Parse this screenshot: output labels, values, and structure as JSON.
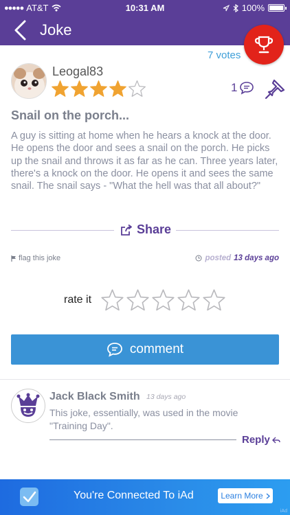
{
  "status_bar": {
    "carrier": "AT&T",
    "time": "10:31 AM",
    "battery": "100%"
  },
  "nav": {
    "title": "Joke"
  },
  "joke": {
    "votes": "7 votes",
    "author": "Leogal83",
    "rating": 4,
    "rating_max": 5,
    "comment_count": "1",
    "title": "Snail on the porch...",
    "body": "A guy is sitting at home when he hears a knock at the door. He opens the door and sees a snail on the porch. He picks up the snail and throws it as far as he can. Three years later, there's a knock on the door. He opens it and sees the same snail. The snail says -  \"What the hell was that all about?\"",
    "share_label": "Share",
    "flag_label": "flag this joke",
    "posted_label": "posted",
    "posted_when": "13 days ago"
  },
  "rate": {
    "label": "rate it",
    "value": 0,
    "max": 5
  },
  "comment_button": {
    "label": "comment"
  },
  "comments": [
    {
      "name": "Jack Black Smith",
      "time": "13 days ago",
      "text": "This joke, essentially, was used in the movie \"Training Day\".",
      "reply_label": "Reply"
    }
  ],
  "ad": {
    "text": "You're Connected To iAd",
    "button": "Learn More",
    "brand": "iAd"
  },
  "colors": {
    "brand_purple": "#5a3e97",
    "star_orange": "#f0a331",
    "accent_blue": "#3a93d6",
    "trophy_red": "#e2231a"
  }
}
